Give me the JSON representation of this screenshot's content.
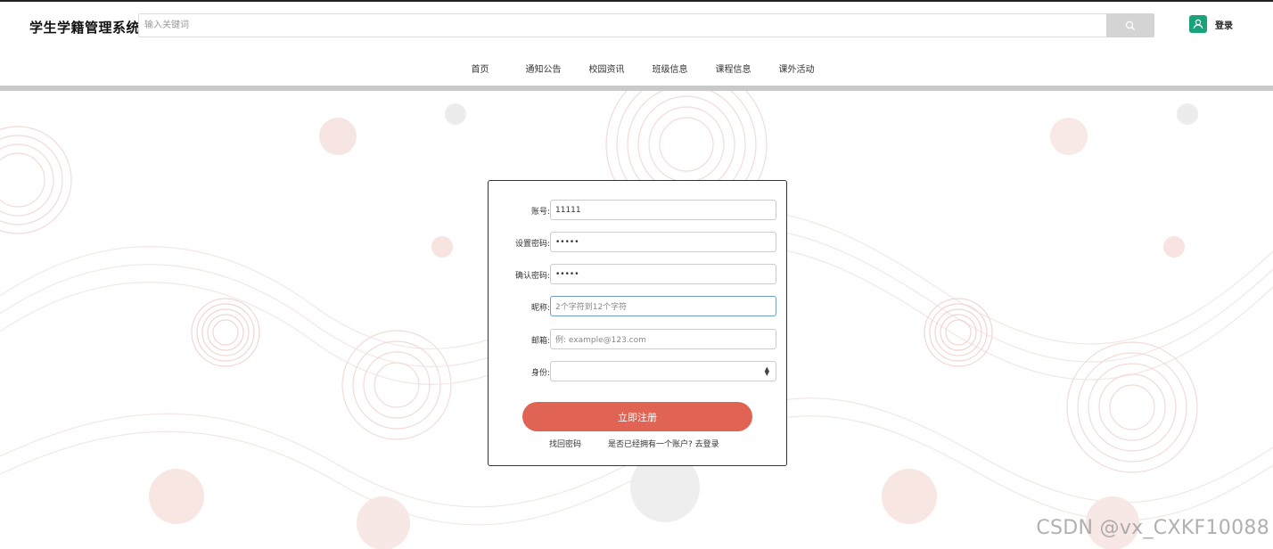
{
  "header": {
    "title": "学生学籍管理系统",
    "search_placeholder": "输入关键词",
    "login_label": "登录",
    "accent_color": "#1aa37a"
  },
  "nav": {
    "items": [
      {
        "label": "首页",
        "color": "#16a07a"
      },
      {
        "label": "通知公告",
        "color": "#da5d4c"
      },
      {
        "label": "校园资讯",
        "color": "#e9aa45"
      },
      {
        "label": "班级信息",
        "color": "#2d7fbf"
      },
      {
        "label": "课程信息",
        "color": "#16a07a"
      },
      {
        "label": "课外活动",
        "color": "#da5d4c"
      }
    ]
  },
  "form": {
    "account_label": "账号:",
    "account_value": "11111",
    "password_label": "设置密码:",
    "password_value": "•••••",
    "confirm_label": "确认密码:",
    "confirm_value": "•••••",
    "nickname_label": "昵称:",
    "nickname_placeholder": "2个字符到12个字符",
    "email_label": "邮箱:",
    "email_placeholder": "例: example@123.com",
    "identity_label": "身份:",
    "identity_value": "",
    "submit_label": "立即注册",
    "forgot_label": "找回密码",
    "have_account_label": "是否已经拥有一个账户? 去登录",
    "submit_color": "#e06353"
  },
  "watermark": "CSDN @vx_CXKF10088"
}
